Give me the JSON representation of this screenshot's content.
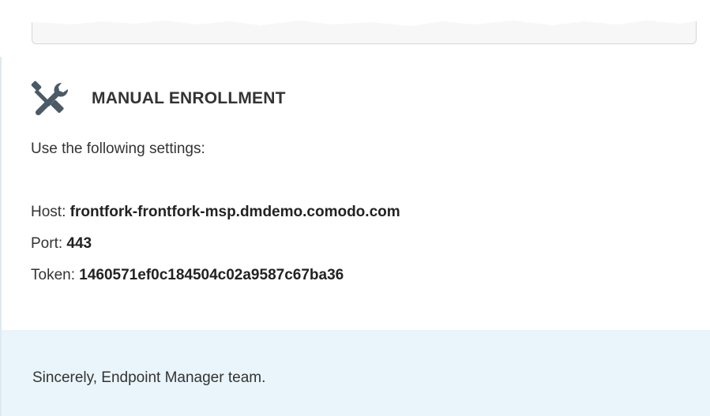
{
  "section": {
    "icon": "tools-icon",
    "title": "MANUAL ENROLLMENT"
  },
  "intro": "Use the following settings:",
  "settings": {
    "host_label": "Host:",
    "host_value": "frontfork-frontfork-msp.dmdemo.comodo.com",
    "port_label": "Port:",
    "port_value": "443",
    "token_label": "Token:",
    "token_value": "1460571ef0c184504c02a9587c67ba36"
  },
  "footer": {
    "signature": "Sincerely, Endpoint Manager team."
  },
  "colors": {
    "footer_background": "#eaf5fb",
    "text": "#333333",
    "icon": "#4a5a66"
  }
}
